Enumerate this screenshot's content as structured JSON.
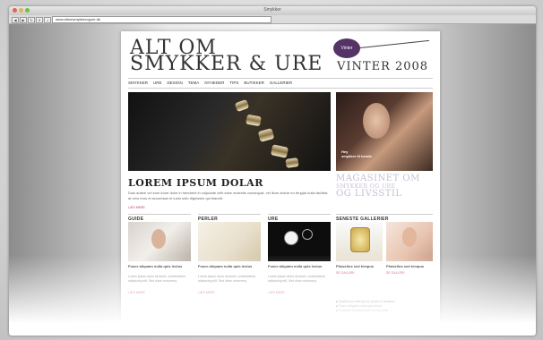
{
  "window": {
    "title": "Smykker",
    "url": "www.altomsmykkerogure.dk"
  },
  "header": {
    "logo_line1": "ALT OM",
    "logo_line2": "SMYKKER & URE",
    "season_badge": "Vinter",
    "season_label": "VINTER 2008"
  },
  "nav": {
    "items": [
      "SMYKKER",
      "URE",
      "DESIGN",
      "TEMA",
      "NYHEDER",
      "TIPS",
      "BUTIKKER",
      "GALLERIER"
    ]
  },
  "feature": {
    "headline": "LOREM IPSUM DOLAR",
    "lead": "Duis autem vel eum iriure dolor in hendrerit in vulputate velit esse molestie consequat, vel illum dolore eu feugiat nulla facilisis at vero eros et accumsan et iusto odio dignissim qui blandit.",
    "readmore": "LÆS MERE",
    "side_caption_1": "Hey",
    "side_caption_2": "smykker til hende"
  },
  "magazine": {
    "line1": "MAGASINET OM",
    "line2": "SMYKKER OG URE",
    "line3": "OG LIVSSTIL"
  },
  "sections": [
    {
      "title": "GUIDE",
      "card_title": "Fusce aliquam nulla quis lectus",
      "card_text": "Lorem ipsum dolor sit amet, consectetuer adipiscing elit. Sed diam nonummy.",
      "readmore": "LÆS MERE"
    },
    {
      "title": "PERLER",
      "card_title": "Fusce aliquam nulla quis lectus",
      "card_text": "Lorem ipsum dolor sit amet, consectetuer adipiscing elit. Sed diam nonummy.",
      "readmore": "LÆS MERE"
    },
    {
      "title": "URE",
      "card_title": "Fusce aliquam nulla quis lectus",
      "card_text": "Lorem ipsum dolor sit amet, consectetuer adipiscing elit. Sed diam nonummy.",
      "readmore": "LÆS MERE"
    }
  ],
  "gallery": {
    "title": "SENESTE GALLERIER",
    "items": [
      {
        "caption": "Phasellus sed tempus",
        "link": "SE GALLERI"
      },
      {
        "caption": "Phasellus sed tempus",
        "link": "SE GALLERI"
      }
    ],
    "bullets": [
      "Vestibulum ante ipsum primis in faucibus",
      "Fusce aliquam nulla quis lectus",
      "Curabitur tincidunt ante ac est porta"
    ]
  }
}
